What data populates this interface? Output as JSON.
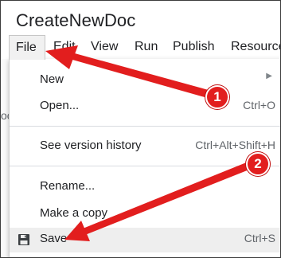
{
  "document": {
    "title": "CreateNewDoc"
  },
  "menubar": {
    "items": [
      {
        "label": "File"
      },
      {
        "label": "Edit"
      },
      {
        "label": "View"
      },
      {
        "label": "Run"
      },
      {
        "label": "Publish"
      },
      {
        "label": "Resources"
      }
    ]
  },
  "background": {
    "fragment": "oc"
  },
  "file_menu": {
    "new": {
      "label": "New"
    },
    "open": {
      "label": "Open...",
      "shortcut": "Ctrl+O"
    },
    "version_history": {
      "label": "See version history",
      "shortcut": "Ctrl+Alt+Shift+H"
    },
    "rename": {
      "label": "Rename..."
    },
    "make_copy": {
      "label": "Make a copy"
    },
    "save": {
      "label": "Save",
      "shortcut": "Ctrl+S",
      "icon": "floppy-disk-icon"
    }
  },
  "annotations": {
    "badges": [
      {
        "label": "1"
      },
      {
        "label": "2"
      }
    ],
    "color": "#e21e1e"
  }
}
